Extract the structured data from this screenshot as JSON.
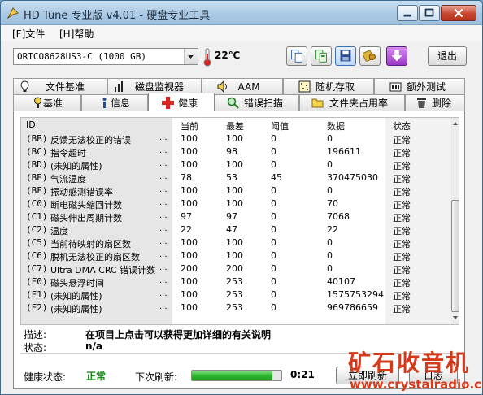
{
  "window": {
    "title": "HD Tune 专业版 v4.01 - 硬盘专业工具"
  },
  "menu": [
    {
      "key": "[F]",
      "label": "文件"
    },
    {
      "key": "[H]",
      "label": "帮助"
    }
  ],
  "toolbar": {
    "drive": "ORICO8628US3-C (1000 GB)",
    "temperature": "22℃",
    "icons": [
      "copy-icon",
      "copy-text-icon",
      "save-icon",
      "hdd-options-icon",
      "download-icon"
    ],
    "exit_label": "退出"
  },
  "tabs_top": [
    {
      "label": "文件基准",
      "icon": "file-benchmark-icon"
    },
    {
      "label": "磁盘监视器",
      "icon": "disk-monitor-icon"
    },
    {
      "label": "AAM",
      "icon": "speaker-icon"
    },
    {
      "label": "随机存取",
      "icon": "random-access-icon"
    },
    {
      "label": "额外测试",
      "icon": "extra-tests-icon"
    }
  ],
  "tabs_bottom": [
    {
      "label": "基准",
      "icon": "benchmark-icon"
    },
    {
      "label": "信息",
      "icon": "info-icon"
    },
    {
      "label": "健康",
      "icon": "health-cross-icon",
      "active": true
    },
    {
      "label": "错误扫描",
      "icon": "error-scan-icon"
    },
    {
      "label": "文件夹占用率",
      "icon": "folder-usage-icon"
    },
    {
      "label": "删除",
      "icon": "erase-icon"
    }
  ],
  "table": {
    "columns": [
      "ID",
      "当前",
      "最差",
      "阈值",
      "数据",
      "状态"
    ],
    "rows": [
      {
        "id": "(BB)",
        "name": "反馈无法校正的错误",
        "current": "100",
        "worst": "100",
        "threshold": "0",
        "data": "0",
        "status": "正常"
      },
      {
        "id": "(BC)",
        "name": "指令超时",
        "current": "100",
        "worst": "98",
        "threshold": "0",
        "data": "196611",
        "status": "正常"
      },
      {
        "id": "(BD)",
        "name": "(未知的属性)",
        "current": "100",
        "worst": "100",
        "threshold": "0",
        "data": "0",
        "status": "正常"
      },
      {
        "id": "(BE)",
        "name": "气流温度",
        "current": "78",
        "worst": "53",
        "threshold": "45",
        "data": "370475030",
        "status": "正常"
      },
      {
        "id": "(BF)",
        "name": "振动感测错误率",
        "current": "100",
        "worst": "100",
        "threshold": "0",
        "data": "0",
        "status": "正常"
      },
      {
        "id": "(C0)",
        "name": "断电磁头缩回计数",
        "current": "100",
        "worst": "100",
        "threshold": "0",
        "data": "70",
        "status": "正常"
      },
      {
        "id": "(C1)",
        "name": "磁头伸出周期计数",
        "current": "97",
        "worst": "97",
        "threshold": "0",
        "data": "7068",
        "status": "正常"
      },
      {
        "id": "(C2)",
        "name": "温度",
        "current": "22",
        "worst": "47",
        "threshold": "0",
        "data": "22",
        "status": "正常"
      },
      {
        "id": "(C5)",
        "name": "当前待映射的扇区数",
        "current": "100",
        "worst": "100",
        "threshold": "0",
        "data": "0",
        "status": "正常"
      },
      {
        "id": "(C6)",
        "name": "脱机无法校正的扇区数",
        "current": "100",
        "worst": "100",
        "threshold": "0",
        "data": "0",
        "status": "正常"
      },
      {
        "id": "(C7)",
        "name": "Ultra DMA CRC 错误计数",
        "current": "200",
        "worst": "200",
        "threshold": "0",
        "data": "0",
        "status": "正常"
      },
      {
        "id": "(F0)",
        "name": "磁头悬浮时间",
        "current": "100",
        "worst": "253",
        "threshold": "0",
        "data": "40107",
        "status": "正常"
      },
      {
        "id": "(F1)",
        "name": "(未知的属性)",
        "current": "100",
        "worst": "253",
        "threshold": "0",
        "data": "1575753294",
        "status": "正常"
      },
      {
        "id": "(F2)",
        "name": "(未知的属性)",
        "current": "100",
        "worst": "253",
        "threshold": "0",
        "data": "969786659",
        "status": "正常"
      }
    ],
    "ellipsis": "..."
  },
  "details": {
    "desc_label": "描述:",
    "desc_value": "在项目上点击可以获得更加详细的有关说明",
    "state_label": "状态:",
    "state_value": "n/a"
  },
  "footer": {
    "health_label": "健康状态:",
    "health_value": "正常",
    "refresh_label": "下次刷新:",
    "progress": 0.9,
    "countdown": "0:21",
    "refresh_button": "立即刷新",
    "log_button": "日志"
  },
  "watermark": {
    "line1": "矿石收音机",
    "line2": "www.crystalradio.cn"
  }
}
